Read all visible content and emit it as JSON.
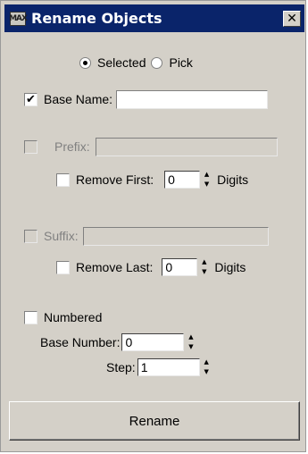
{
  "window": {
    "title": "Rename Objects",
    "app_icon_text": "MAX",
    "close_glyph": "✕"
  },
  "selection_mode": {
    "options": [
      {
        "label": "Selected",
        "checked": true
      },
      {
        "label": "Pick",
        "checked": false
      }
    ]
  },
  "base_name": {
    "label": "Base Name:",
    "checked": true,
    "value": "",
    "check_glyph": "✔"
  },
  "prefix": {
    "label": "Prefix:",
    "checked": false,
    "enabled": false,
    "value": "",
    "remove_first": {
      "label": "Remove First:",
      "checked": false,
      "value": "0",
      "unit": "Digits"
    }
  },
  "suffix": {
    "label": "Suffix:",
    "checked": false,
    "enabled": false,
    "value": "",
    "remove_last": {
      "label": "Remove Last:",
      "checked": false,
      "value": "0",
      "unit": "Digits"
    }
  },
  "numbered": {
    "label": "Numbered",
    "checked": false,
    "base_number": {
      "label": "Base Number:",
      "value": "0"
    },
    "step": {
      "label": "Step:",
      "value": "1"
    }
  },
  "actions": {
    "rename_label": "Rename"
  },
  "spinner": {
    "up": "▲",
    "down": "▼"
  }
}
